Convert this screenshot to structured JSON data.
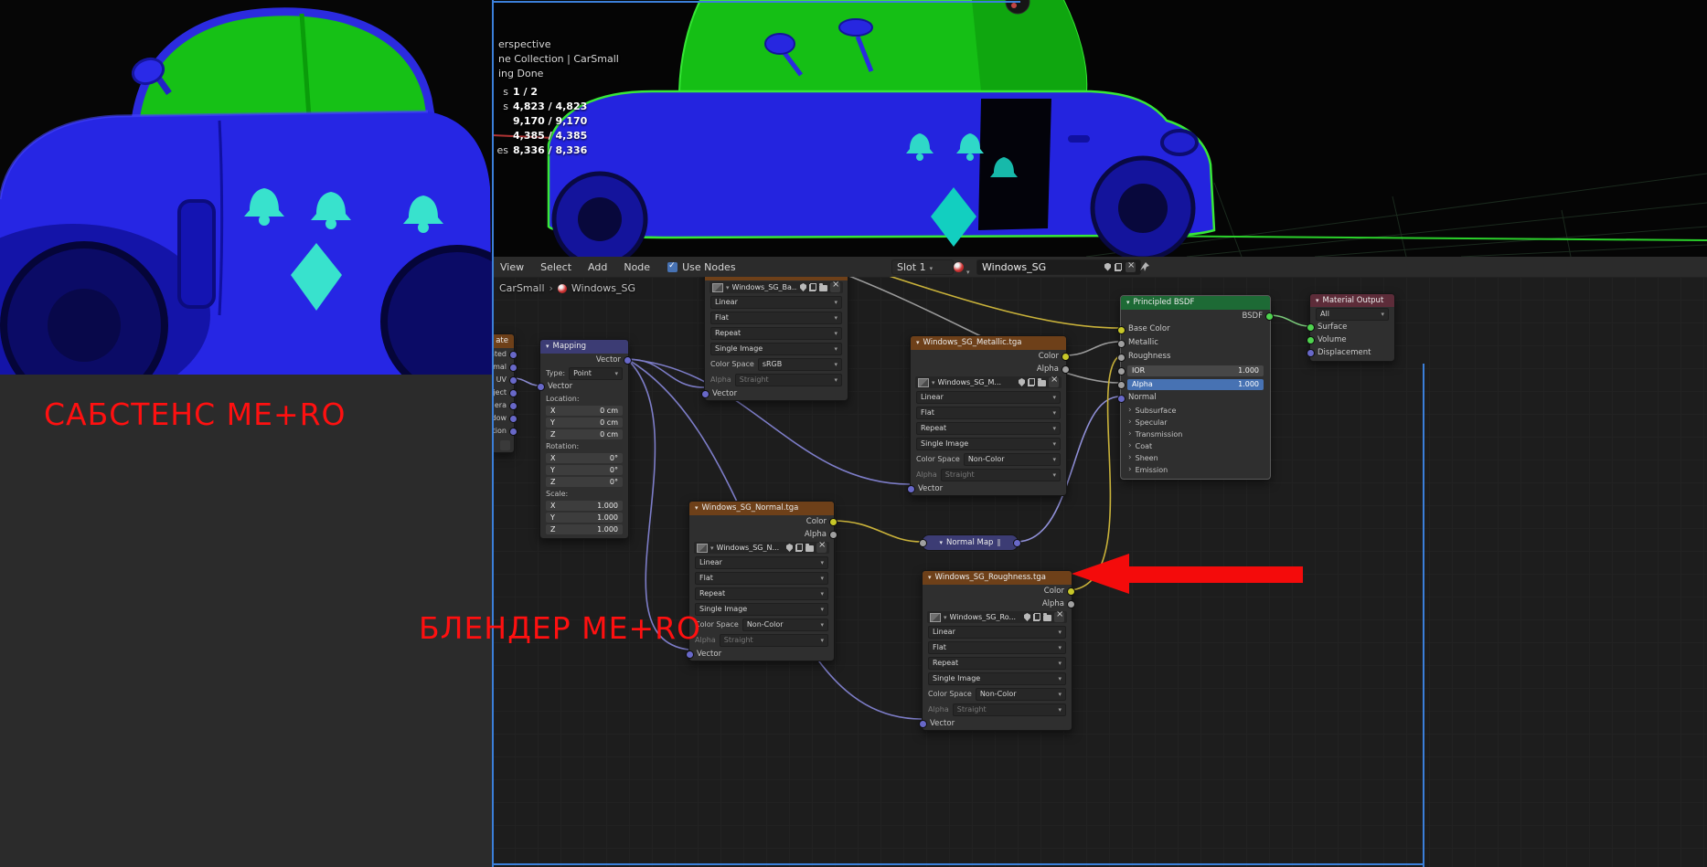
{
  "colors": {
    "annotation_red": "#ff1010",
    "accent_blue": "#4772b3",
    "selection_green": "#38e838",
    "texture_node_header": "#6e4019",
    "vector_node_header": "#3c3c74",
    "shader_node_header": "#1d6a35",
    "output_node_header": "#5d2c39",
    "noodle_yellow": "#c9b23a",
    "noodle_purple": "#7d7dc8",
    "noodle_gray": "#9a9a9a"
  },
  "annotations": {
    "substance_label": "САБСТЕНС ME+RO",
    "blender_label": "БЛЕНДЕР ME+RO"
  },
  "viewport": {
    "overlay_line_1": "erspective",
    "overlay_line_2": "ne Collection | CarSmall",
    "overlay_line_3": "ing Done",
    "stats": [
      {
        "label": "s",
        "value": "1 / 2"
      },
      {
        "label": "s",
        "value": "4,823 / 4,823"
      },
      {
        "label": "",
        "value": "9,170 / 9,170"
      },
      {
        "label": "",
        "value": "4,385 / 4,385"
      },
      {
        "label": "es",
        "value": "8,336 / 8,336"
      }
    ]
  },
  "header": {
    "menus": [
      "View",
      "Select",
      "Add",
      "Node"
    ],
    "use_nodes_label": "Use Nodes",
    "slot_value": "Slot 1",
    "material_name": "Windows_SG"
  },
  "breadcrumb": {
    "object_name": "CarSmall",
    "material_name": "Windows_SG"
  },
  "nodes": {
    "tex_coord": {
      "title": "ate",
      "outputs": [
        "ated",
        "mal",
        "UV",
        "ject",
        "era",
        "dow",
        "tion"
      ]
    },
    "mapping": {
      "title": "Mapping",
      "output": "Vector",
      "type_label": "Type:",
      "type_value": "Point",
      "input": "Vector",
      "location_label": "Location:",
      "rotation_label": "Rotation:",
      "scale_label": "Scale:",
      "location": [
        {
          "axis": "X",
          "value": "0 cm"
        },
        {
          "axis": "Y",
          "value": "0 cm"
        },
        {
          "axis": "Z",
          "value": "0 cm"
        }
      ],
      "rotation": [
        {
          "axis": "X",
          "value": "0°"
        },
        {
          "axis": "Y",
          "value": "0°"
        },
        {
          "axis": "Z",
          "value": "0°"
        }
      ],
      "scale": [
        {
          "axis": "X",
          "value": "1.000"
        },
        {
          "axis": "Y",
          "value": "1.000"
        },
        {
          "axis": "Z",
          "value": "1.000"
        }
      ]
    },
    "tex_base": {
      "image_name": "Windows_SG_Ba...",
      "interpolation": "Linear",
      "projection": "Flat",
      "extension": "Repeat",
      "source": "Single Image",
      "color_space_label": "Color Space",
      "color_space": "sRGB",
      "alpha_label": "Alpha",
      "alpha_mode": "Straight",
      "input": "Vector"
    },
    "tex_metallic": {
      "title": "Windows_SG_Metallic.tga",
      "out_color": "Color",
      "out_alpha": "Alpha",
      "image_name": "Windows_SG_M...",
      "interpolation": "Linear",
      "projection": "Flat",
      "extension": "Repeat",
      "source": "Single Image",
      "color_space_label": "Color Space",
      "color_space": "Non-Color",
      "alpha_label": "Alpha",
      "alpha_mode": "Straight",
      "input": "Vector"
    },
    "tex_normal": {
      "title": "Windows_SG_Normal.tga",
      "out_color": "Color",
      "out_alpha": "Alpha",
      "image_name": "Windows_SG_N...",
      "interpolation": "Linear",
      "projection": "Flat",
      "extension": "Repeat",
      "source": "Single Image",
      "color_space_label": "Color Space",
      "color_space": "Non-Color",
      "alpha_label": "Alpha",
      "alpha_mode": "Straight",
      "input": "Vector"
    },
    "normal_map": {
      "title": "Normal Map"
    },
    "tex_roughness": {
      "title": "Windows_SG_Roughness.tga",
      "out_color": "Color",
      "out_alpha": "Alpha",
      "image_name": "Windows_SG_Ro...",
      "interpolation": "Linear",
      "projection": "Flat",
      "extension": "Repeat",
      "source": "Single Image",
      "color_space_label": "Color Space",
      "color_space": "Non-Color",
      "alpha_label": "Alpha",
      "alpha_mode": "Straight",
      "input": "Vector"
    },
    "principled": {
      "title": "Principled BSDF",
      "output": "BSDF",
      "in_base_color": "Base Color",
      "in_metallic": "Metallic",
      "in_roughness": "Roughness",
      "ior_label": "IOR",
      "ior_value": "1.000",
      "alpha_label": "Alpha",
      "alpha_value": "1.000",
      "in_normal": "Normal",
      "sections": [
        "Subsurface",
        "Specular",
        "Transmission",
        "Coat",
        "Sheen",
        "Emission"
      ]
    },
    "material_output": {
      "title": "Material Output",
      "target": "All",
      "inputs": [
        "Surface",
        "Volume",
        "Displacement"
      ]
    }
  }
}
